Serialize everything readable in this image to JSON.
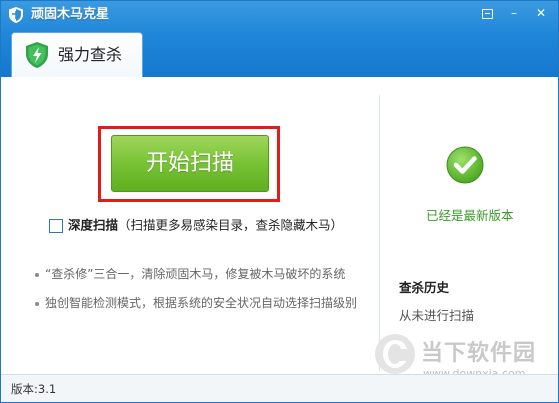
{
  "window": {
    "title": "顽固木马克星",
    "controls": {
      "menu": "menu-icon",
      "minimize": "minimize-icon",
      "close": "close-icon"
    }
  },
  "tabs": [
    {
      "label": "强力查杀",
      "icon": "shield-lightning-icon"
    }
  ],
  "main": {
    "scan_button_label": "开始扫描",
    "deep_scan": {
      "label": "深度扫描",
      "description": "（扫描更多易感染目录，查杀隐藏木马）",
      "checked": false
    },
    "features": [
      "“查杀修”三合一，清除顽固木马，修复被木马破坏的系统",
      "独创智能检测模式，根据系统的安全状况自动选择扫描级别"
    ]
  },
  "side": {
    "status_icon": "green-check-icon",
    "status_text": "已经是最新版本",
    "history_title": "查杀历史",
    "history_text": "从未进行扫描"
  },
  "watermark": {
    "name": "当下软件园",
    "url": "www.downxia.com"
  },
  "footer": {
    "version": "版本:3.1"
  },
  "colors": {
    "titlebar": "#1f86d8",
    "scan_button": "#78c236",
    "highlight": "#e21b1b",
    "status_green": "#3a9b28"
  }
}
